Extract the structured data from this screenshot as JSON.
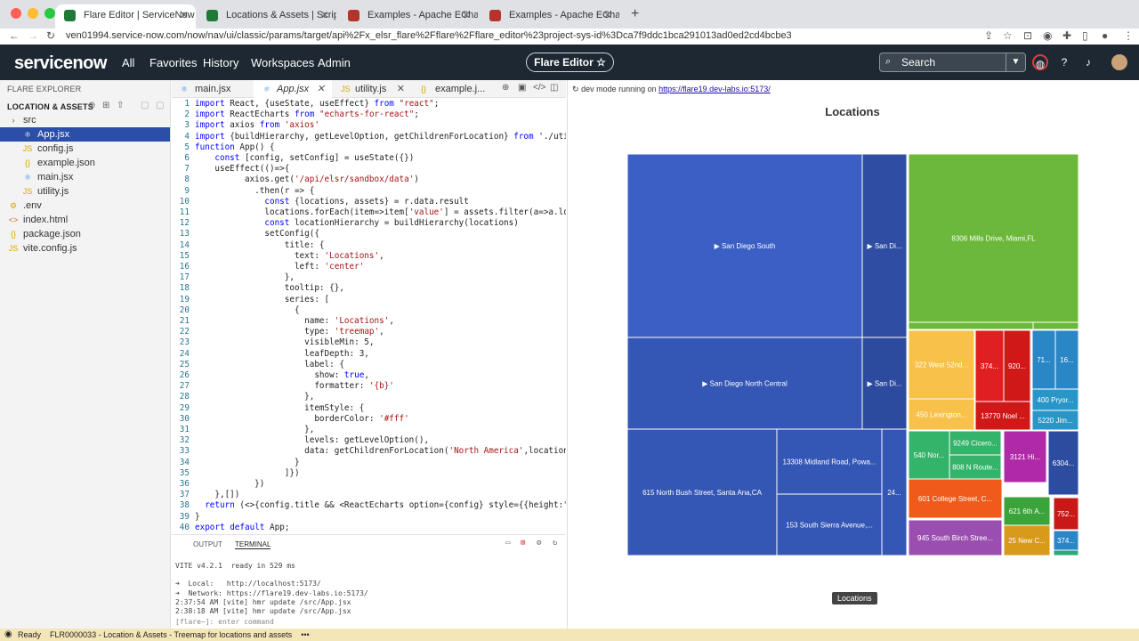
{
  "browser": {
    "tabs": [
      {
        "title": "Flare Editor | ServiceNow",
        "active": true,
        "color": "#1f7a3a"
      },
      {
        "title": "Locations & Assets | Scripted R",
        "active": false,
        "color": "#1f7a3a"
      },
      {
        "title": "Examples - Apache ECharts",
        "active": false,
        "color": "#b8322d"
      },
      {
        "title": "Examples - Apache ECharts",
        "active": false,
        "color": "#b8322d"
      }
    ],
    "new_tab": "+",
    "url": "ven01994.service-now.com/now/nav/ui/classic/params/target/api%2Fx_elsr_flare%2Fflare%2Fflare_editor%23project-sys-id%3Dca7f9ddc1bca291013ad0ed2cd4bcbe3"
  },
  "header": {
    "logo": "servicenow",
    "nav": [
      "All",
      "Favorites",
      "History",
      "Workspaces",
      "Admin"
    ],
    "app_pill": "Flare Editor ☆",
    "search_placeholder": "Search",
    "icons": [
      "globe-icon",
      "help-icon",
      "bell-icon",
      "avatar"
    ]
  },
  "explorer": {
    "title": "FLARE EXPLORER",
    "section": "LOCATION & ASSETS",
    "items": [
      {
        "label": "src",
        "kind": "folder",
        "depth": 0,
        "icon": "›"
      },
      {
        "label": "App.jsx",
        "kind": "react",
        "depth": 2,
        "selected": true,
        "icon": "⚛"
      },
      {
        "label": "config.js",
        "kind": "js",
        "depth": 2,
        "icon": "JS"
      },
      {
        "label": "example.json",
        "kind": "json",
        "depth": 2,
        "icon": "{}"
      },
      {
        "label": "main.jsx",
        "kind": "react",
        "depth": 2,
        "icon": "⚛"
      },
      {
        "label": "utility.js",
        "kind": "js",
        "depth": 2,
        "icon": "JS"
      },
      {
        "label": ".env",
        "kind": "env",
        "depth": 0,
        "icon": "⚙"
      },
      {
        "label": "index.html",
        "kind": "html",
        "depth": 0,
        "icon": "<>"
      },
      {
        "label": "package.json",
        "kind": "json",
        "depth": 0,
        "icon": "{}"
      },
      {
        "label": "vite.config.js",
        "kind": "js",
        "depth": 0,
        "icon": "JS"
      }
    ]
  },
  "editor": {
    "tabs": [
      {
        "label": "main.jsx",
        "icon": "⚛",
        "close": "✕"
      },
      {
        "label": "App.jsx",
        "icon": "⚛",
        "close": "✕",
        "active": true
      },
      {
        "label": "utility.js",
        "icon": "JS",
        "close": "✕"
      },
      {
        "label": "example.j...",
        "icon": "{}",
        "close": ""
      }
    ],
    "lines": [
      "import React, {useState, useEffect} from \"react\";",
      "import ReactEcharts from \"echarts-for-react\";",
      "import axios from 'axios'",
      "import {buildHierarchy, getLevelOption, getChildrenForLocation} from './utility.",
      "function App() {",
      "    const [config, setConfig] = useState({})",
      "    useEffect(()=>{",
      "          axios.get('/api/elsr/sandbox/data')",
      "            .then(r => {",
      "              const {locations, assets} = r.data.result",
      "              locations.forEach(item=>item['value'] = assets.filter(a=>a.locatio",
      "              const locationHierarchy = buildHierarchy(locations)",
      "              setConfig({",
      "                  title: {",
      "                    text: 'Locations',",
      "                    left: 'center'",
      "                  },",
      "                  tooltip: {},",
      "                  series: [",
      "                    {",
      "                      name: 'Locations',",
      "                      type: 'treemap',",
      "                      visibleMin: 5,",
      "                      leafDepth: 3,",
      "                      label: {",
      "                        show: true,",
      "                        formatter: '{b}'",
      "                      },",
      "                      itemStyle: {",
      "                        borderColor: '#fff'",
      "                      },",
      "                      levels: getLevelOption(),",
      "                      data: getChildrenForLocation('North America',locationHie",
      "                    }",
      "                  ]})",
      "            })",
      "    },[])",
      "  return (<>{config.title && <ReactEcharts option={config} style={{height:\"95vh\"",
      "}",
      "export default App;"
    ]
  },
  "terminal": {
    "tabs": [
      "OUTPUT",
      "TERMINAL"
    ],
    "lines": [
      "VITE v4.2.1  ready in 529 ms",
      "",
      "➜  Local:   http://localhost:5173/",
      "➜  Network: https://flare19.dev-labs.io:5173/",
      "2:37:54 AM [vite] hmr update /src/App.jsx",
      "2:38:18 AM [vite] hmr update /src/App.jsx"
    ],
    "prompt": "[flare~]: enter command"
  },
  "preview": {
    "dev_prefix": "dev mode running on",
    "dev_url": "https://flare19.dev-labs.io:5173/",
    "tooltip": "Locations"
  },
  "chart_data": {
    "type": "treemap",
    "title": "Locations",
    "leaves": [
      {
        "label": "▶ San Diego South",
        "color": "#3b5fc4"
      },
      {
        "label": "▶ San Di...",
        "color": "#2f4ea3"
      },
      {
        "label": "▶ San Diego North Central",
        "color": "#3456b4"
      },
      {
        "label": "▶ San Di...",
        "color": "#2d4b9e"
      },
      {
        "label": "615 North Bush Street, Santa Ana,CA",
        "color": "#3456b4"
      },
      {
        "label": "13308 Midland Road, Powa...",
        "color": "#3456b4"
      },
      {
        "label": "153 South Sierra Avenue,...",
        "color": "#3456b4"
      },
      {
        "label": "24...",
        "color": "#3456b4"
      },
      {
        "label": "8306 Mills Drive, Miami,FL",
        "color": "#6bb83a"
      },
      {
        "label": "",
        "color": "#6bb83a"
      },
      {
        "label": "",
        "color": "#6bb83a"
      },
      {
        "label": "322 West 52nd...",
        "color": "#f7c14a"
      },
      {
        "label": "450 Lexington...",
        "color": "#f7c14a"
      },
      {
        "label": "374...",
        "color": "#e02020"
      },
      {
        "label": "920...",
        "color": "#d01818"
      },
      {
        "label": "13770 Noel ...",
        "color": "#d01818"
      },
      {
        "label": "71...",
        "color": "#2a86c4"
      },
      {
        "label": "16...",
        "color": "#2a86c4"
      },
      {
        "label": "400 Pryor...",
        "color": "#2a96c8"
      },
      {
        "label": "5220 Jim...",
        "color": "#2a96c8"
      },
      {
        "label": "540 Nor...",
        "color": "#34b36a"
      },
      {
        "label": "9249 Cicero...",
        "color": "#34b36a"
      },
      {
        "label": "808 N Route...",
        "color": "#34b36a"
      },
      {
        "label": "3121 Hi...",
        "color": "#b02aa8"
      },
      {
        "label": "6304...",
        "color": "#2c4ca0"
      },
      {
        "label": "601 College Street, C...",
        "color": "#f05a1a"
      },
      {
        "label": "621 6th A...",
        "color": "#3aa33a"
      },
      {
        "label": "752...",
        "color": "#c81818"
      },
      {
        "label": "945 South Birch Stree...",
        "color": "#9a4fb0"
      },
      {
        "label": "25 New C...",
        "color": "#d89a1a"
      },
      {
        "label": "374...",
        "color": "#2a86c4"
      },
      {
        "label": "",
        "color": "#2aa87a"
      }
    ]
  },
  "statusbar": {
    "ready": "Ready",
    "text": "FLR0000033 - Location & Assets - Treemap for locations and assets",
    "more": "•••"
  }
}
